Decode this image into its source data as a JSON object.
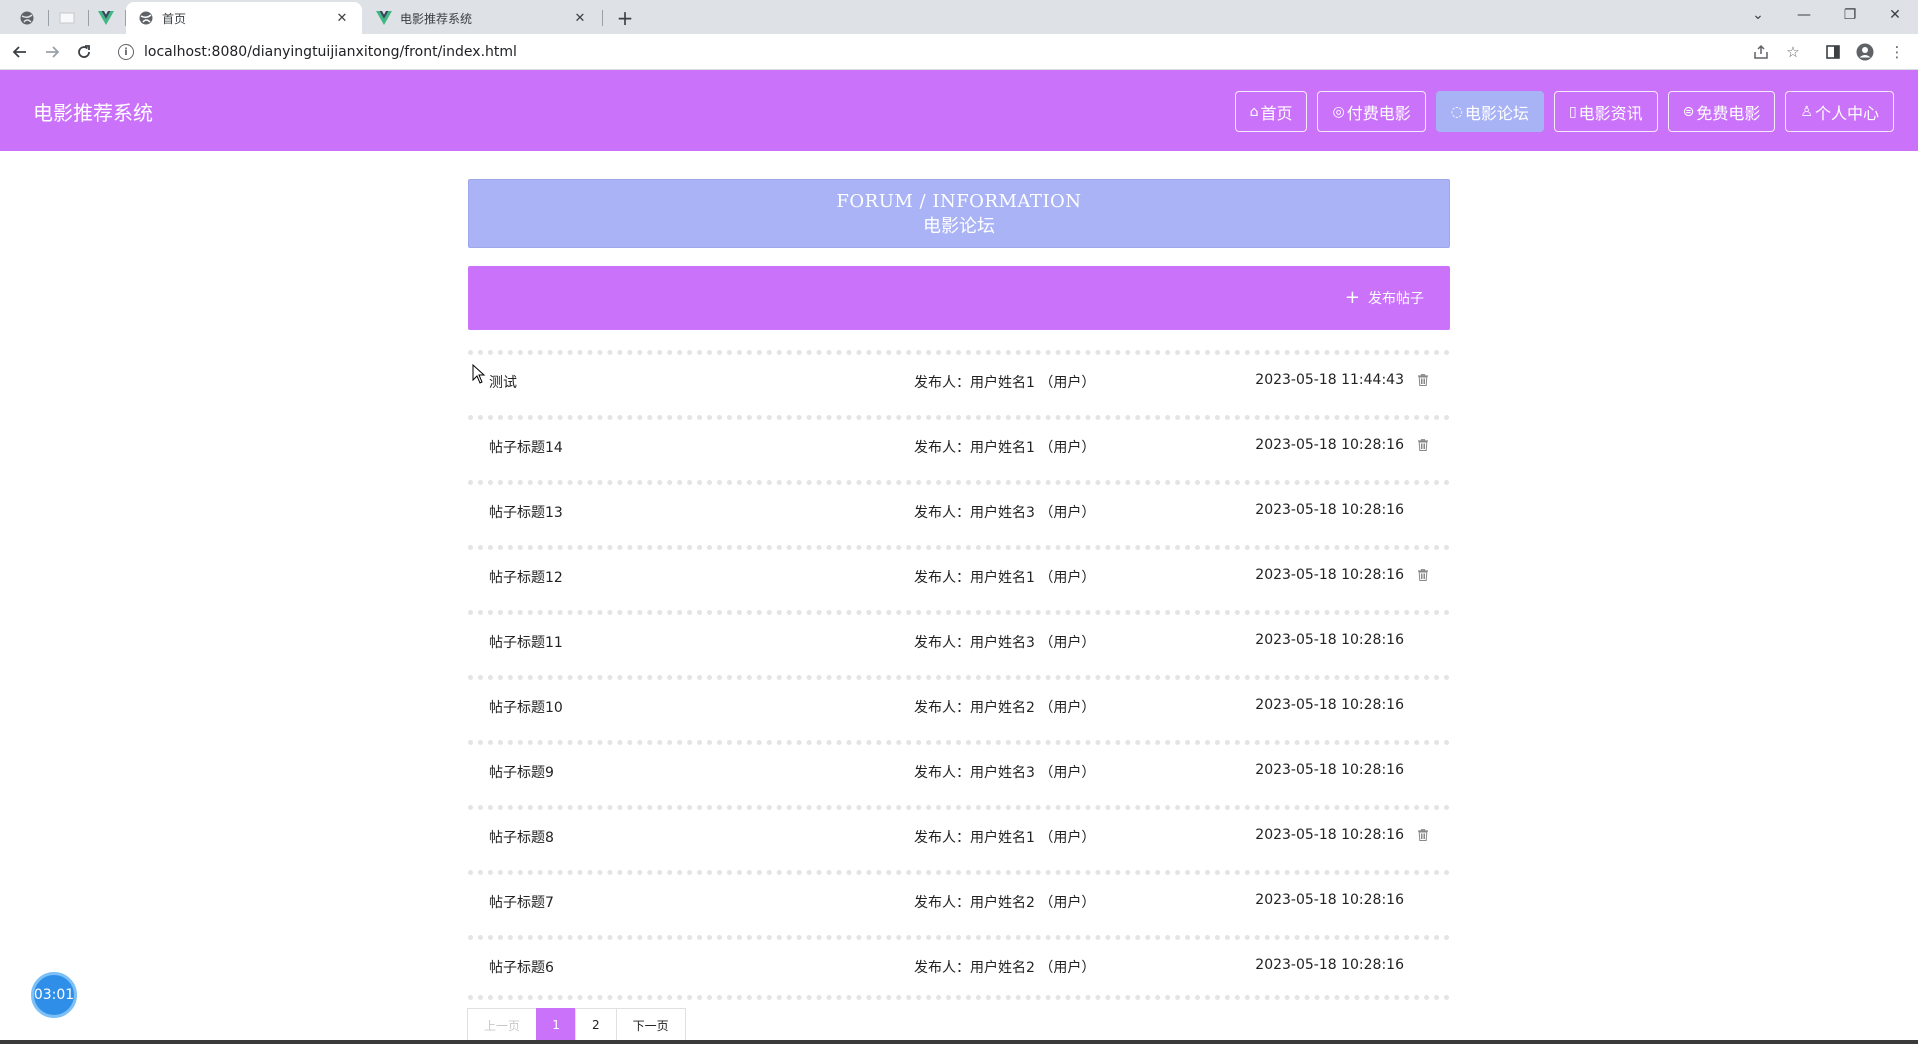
{
  "browser": {
    "tabs": [
      {
        "title": "首页",
        "icon": "globe-icon",
        "active": true
      },
      {
        "title": "电影推荐系统",
        "icon": "vue-logo-icon",
        "active": false
      }
    ],
    "url": "localhost:8080/dianyingtuijianxitong/front/index.html"
  },
  "site": {
    "brand": "电影推荐系统",
    "brand_color": "#cb72fb",
    "nav": [
      {
        "label": "首页",
        "icon": "home-icon",
        "active": false
      },
      {
        "label": "付费电影",
        "icon": "film-icon",
        "active": false
      },
      {
        "label": "电影论坛",
        "icon": "chat-icon",
        "active": true
      },
      {
        "label": "电影资讯",
        "icon": "news-icon",
        "active": false
      },
      {
        "label": "免费电影",
        "icon": "gift-icon",
        "active": false
      },
      {
        "label": "个人中心",
        "icon": "user-icon",
        "active": false
      }
    ]
  },
  "banner": {
    "en": "FORUM / INFORMATION",
    "cn": "电影论坛"
  },
  "actions": {
    "publish_label": "发布帖子"
  },
  "posts": [
    {
      "title": "测试",
      "author": "发布人：用户姓名1 （用户）",
      "time": "2023-05-18 11:44:43",
      "deletable": true
    },
    {
      "title": "帖子标题14",
      "author": "发布人：用户姓名1 （用户）",
      "time": "2023-05-18 10:28:16",
      "deletable": true
    },
    {
      "title": "帖子标题13",
      "author": "发布人：用户姓名3 （用户）",
      "time": "2023-05-18 10:28:16",
      "deletable": false
    },
    {
      "title": "帖子标题12",
      "author": "发布人：用户姓名1 （用户）",
      "time": "2023-05-18 10:28:16",
      "deletable": true
    },
    {
      "title": "帖子标题11",
      "author": "发布人：用户姓名3 （用户）",
      "time": "2023-05-18 10:28:16",
      "deletable": false
    },
    {
      "title": "帖子标题10",
      "author": "发布人：用户姓名2 （用户）",
      "time": "2023-05-18 10:28:16",
      "deletable": false
    },
    {
      "title": "帖子标题9",
      "author": "发布人：用户姓名3 （用户）",
      "time": "2023-05-18 10:28:16",
      "deletable": false
    },
    {
      "title": "帖子标题8",
      "author": "发布人：用户姓名1 （用户）",
      "time": "2023-05-18 10:28:16",
      "deletable": true
    },
    {
      "title": "帖子标题7",
      "author": "发布人：用户姓名2 （用户）",
      "time": "2023-05-18 10:28:16",
      "deletable": false
    },
    {
      "title": "帖子标题6",
      "author": "发布人：用户姓名2 （用户）",
      "time": "2023-05-18 10:28:16",
      "deletable": false
    }
  ],
  "pagination": {
    "prev_label": "上一页",
    "pages": [
      "1",
      "2"
    ],
    "current": "1",
    "next_label": "下一页"
  },
  "timer": "03:01"
}
